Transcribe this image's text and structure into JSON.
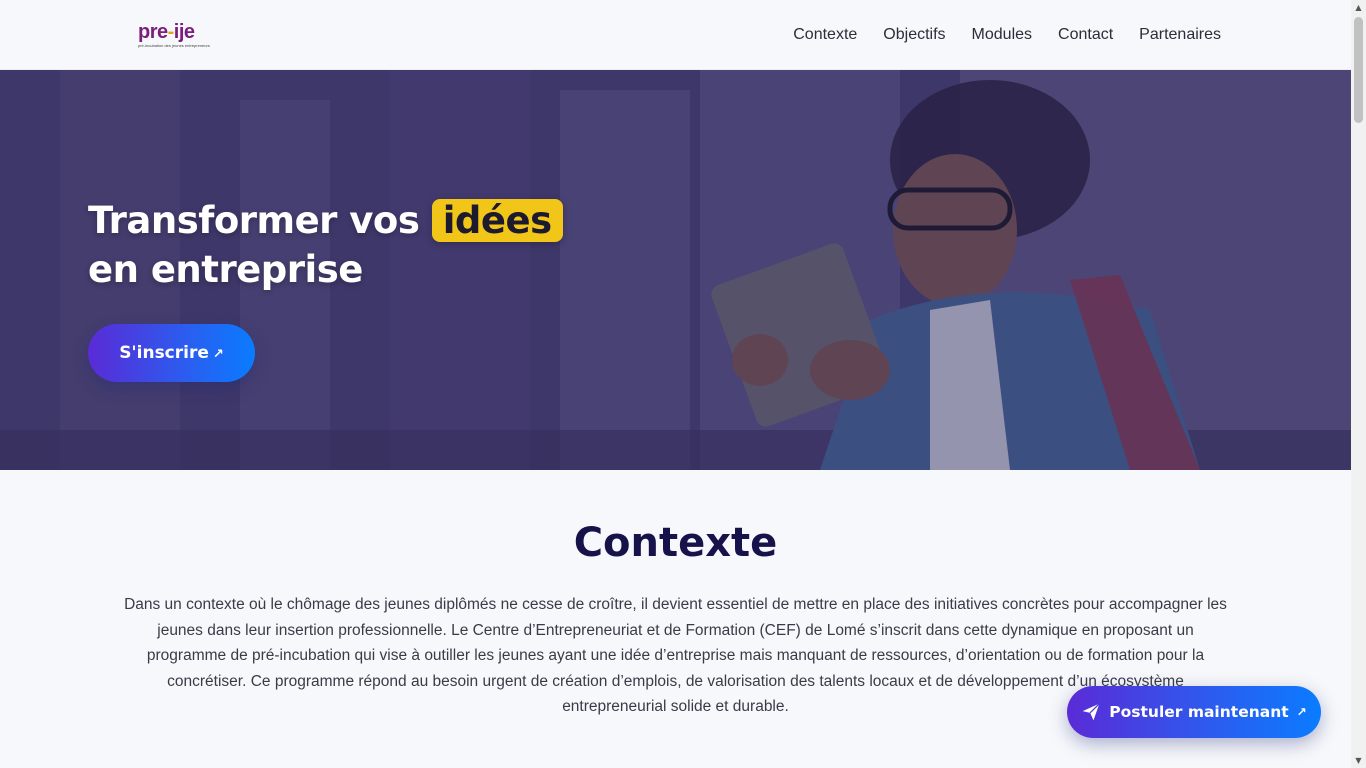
{
  "header": {
    "logo_word_a": "pre",
    "logo_dash": "-",
    "logo_word_b": "ije",
    "logo_tagline": "pré-incubation des jeunes entrepreneurs",
    "nav": [
      "Contexte",
      "Objectifs",
      "Modules",
      "Contact",
      "Partenaires"
    ]
  },
  "hero": {
    "title_part1": "Transformer vos ",
    "title_highlight": "idées",
    "title_part2": "en entreprise",
    "cta_label": "S'inscrire",
    "cta_arrow": "↗"
  },
  "contexte": {
    "title": "Contexte",
    "paragraph": "Dans un contexte où le chômage des jeunes diplômés ne cesse de croître, il devient essentiel de mettre en place des initiatives concrètes pour accompagner les jeunes dans leur insertion professionnelle. Le Centre d’Entrepreneuriat et de Formation (CEF) de Lomé s’inscrit dans cette dynamique en proposant un programme de pré-incubation qui vise à outiller les jeunes ayant une idée d’entreprise mais manquant de ressources, d’orientation ou de formation pour la concrétiser. Ce programme répond au besoin urgent de création d’emplois, de valorisation des talents locaux et de développement d’un écosystème entrepreneurial solide et durable."
  },
  "floating": {
    "apply_label": "Postuler maintenant",
    "apply_arrow": "↗",
    "apply_icon": "paper-plane-icon"
  },
  "colors": {
    "brand_purple": "#7a1f7a",
    "highlight_yellow": "#f2c618",
    "title_navy": "#16124a",
    "gradient_start": "#5a2bd6",
    "gradient_end": "#0a7cff"
  }
}
